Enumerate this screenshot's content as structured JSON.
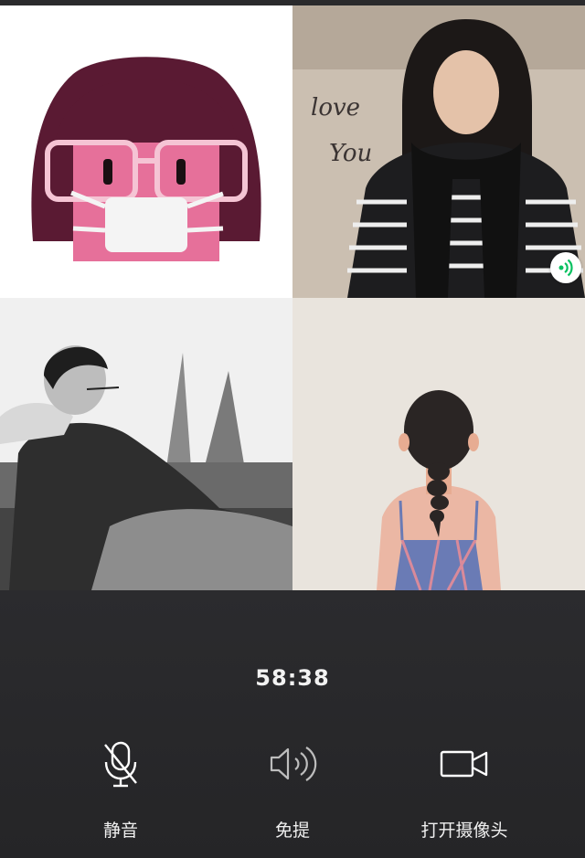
{
  "call": {
    "timer": "58:38",
    "participants": [
      {
        "id": "p1",
        "avatar": "cartoon-masked-girl-avatar"
      },
      {
        "id": "p2",
        "avatar": "woman-striped-sweater-photo",
        "speaking": true
      },
      {
        "id": "p3",
        "avatar": "man-reclining-bw-photo"
      },
      {
        "id": "p4",
        "avatar": "girl-braid-illustration"
      }
    ]
  },
  "controls": {
    "mute_label": "静音",
    "speaker_label": "免提",
    "camera_label": "打开摄像头"
  },
  "icons": {
    "mute": "microphone-muted-icon",
    "speaker": "speaker-icon",
    "camera": "video-camera-icon",
    "speaking": "speaking-indicator-icon"
  },
  "colors": {
    "control_bg": "#2a2a2c",
    "speaking_green": "#07c160",
    "text": "#ffffff"
  }
}
